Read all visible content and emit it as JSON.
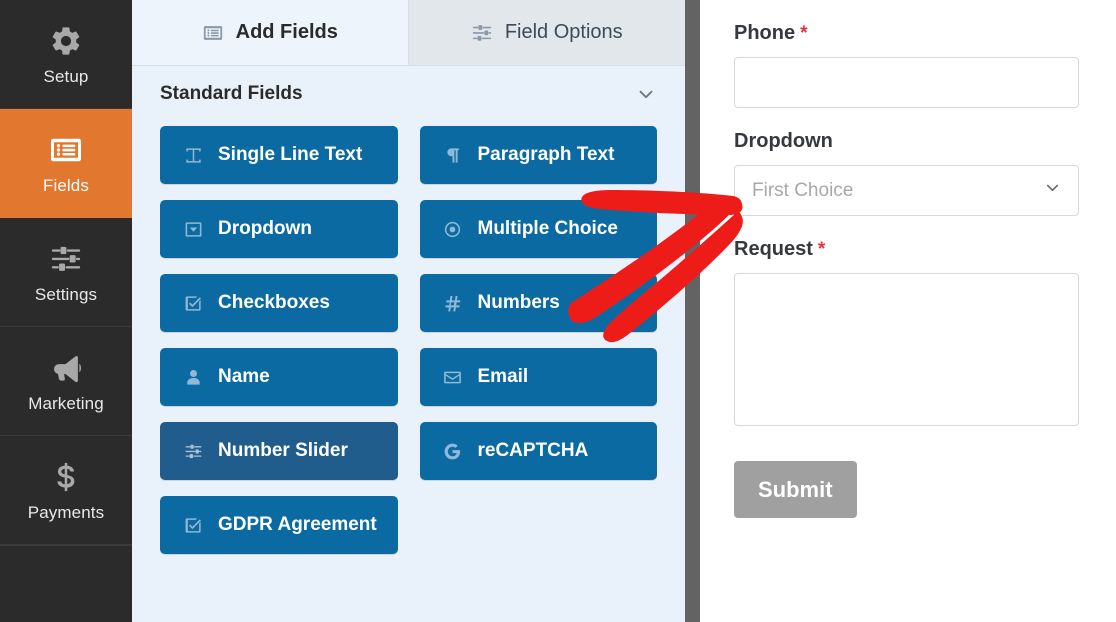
{
  "sidebar": {
    "items": [
      {
        "label": "Setup",
        "icon": "gear-icon",
        "active": false
      },
      {
        "label": "Fields",
        "icon": "list-form-icon",
        "active": true
      },
      {
        "label": "Settings",
        "icon": "sliders-icon",
        "active": false
      },
      {
        "label": "Marketing",
        "icon": "megaphone-icon",
        "active": false
      },
      {
        "label": "Payments",
        "icon": "dollar-icon",
        "active": false
      }
    ],
    "active_color": "#e27730",
    "background_color": "#2b2b2b"
  },
  "builder": {
    "tabs": [
      {
        "label": "Add Fields",
        "icon": "list-form-icon",
        "active": true
      },
      {
        "label": "Field Options",
        "icon": "sliders-icon",
        "active": false
      }
    ],
    "section": {
      "title": "Standard Fields",
      "collapse_icon": "chevron-down-icon"
    },
    "fields": [
      {
        "label": "Single Line Text",
        "icon": "text-cursor-icon",
        "hover": false
      },
      {
        "label": "Paragraph Text",
        "icon": "pilcrow-icon",
        "hover": false
      },
      {
        "label": "Dropdown",
        "icon": "dropdown-icon",
        "hover": false
      },
      {
        "label": "Multiple Choice",
        "icon": "radio-icon",
        "hover": false
      },
      {
        "label": "Checkboxes",
        "icon": "checkbox-icon",
        "hover": false
      },
      {
        "label": "Numbers",
        "icon": "hash-icon",
        "hover": false
      },
      {
        "label": "Name",
        "icon": "user-icon",
        "hover": false
      },
      {
        "label": "Email",
        "icon": "envelope-icon",
        "hover": false
      },
      {
        "label": "Number Slider",
        "icon": "sliders-icon",
        "hover": true
      },
      {
        "label": "reCAPTCHA",
        "icon": "google-g-icon",
        "hover": false
      },
      {
        "label": "GDPR Agreement",
        "icon": "checkbox-icon",
        "hover": false
      }
    ],
    "button_color": "#0b6aa2",
    "button_hover_color": "#215d8c",
    "background_color": "#e9f1fb"
  },
  "preview": {
    "fields": [
      {
        "label": "Phone",
        "required": true,
        "required_mark": "*",
        "type": "text"
      },
      {
        "label": "Dropdown",
        "required": false,
        "required_mark": "",
        "type": "select",
        "value": "First Choice",
        "chevron_icon": "chevron-down-icon"
      },
      {
        "label": "Request",
        "required": true,
        "required_mark": "*",
        "type": "textarea"
      }
    ],
    "submit_label": "Submit",
    "required_color": "#e1333d",
    "submit_color": "#a0a0a0"
  },
  "annotation": {
    "type": "hand-drawn-arrow",
    "color": "#ee1c18",
    "points_to": "Dropdown preview field"
  }
}
